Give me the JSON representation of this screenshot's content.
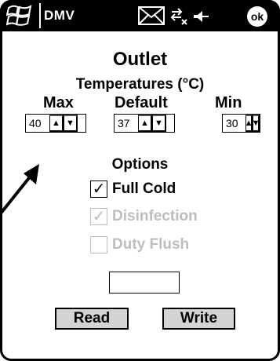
{
  "titlebar": {
    "app_title": "DMV",
    "ok_label": "ok"
  },
  "outlet": {
    "title": "Outlet",
    "temperatures_heading": "Temperatures (°C)",
    "max": {
      "label": "Max",
      "value": "40"
    },
    "default": {
      "label": "Default",
      "value": "37"
    },
    "min": {
      "label": "Min",
      "value": "30"
    },
    "up_arrow": "▲",
    "down_arrow": "▼"
  },
  "options": {
    "heading": "Options",
    "items": [
      {
        "label": "Full Cold",
        "checked": true,
        "enabled": true
      },
      {
        "label": "Disinfection",
        "checked": true,
        "enabled": false
      },
      {
        "label": "Duty Flush",
        "checked": false,
        "enabled": false
      }
    ],
    "check_glyph": "✓"
  },
  "actions": {
    "read_label": "Read",
    "write_label": "Write"
  },
  "status_value": ""
}
